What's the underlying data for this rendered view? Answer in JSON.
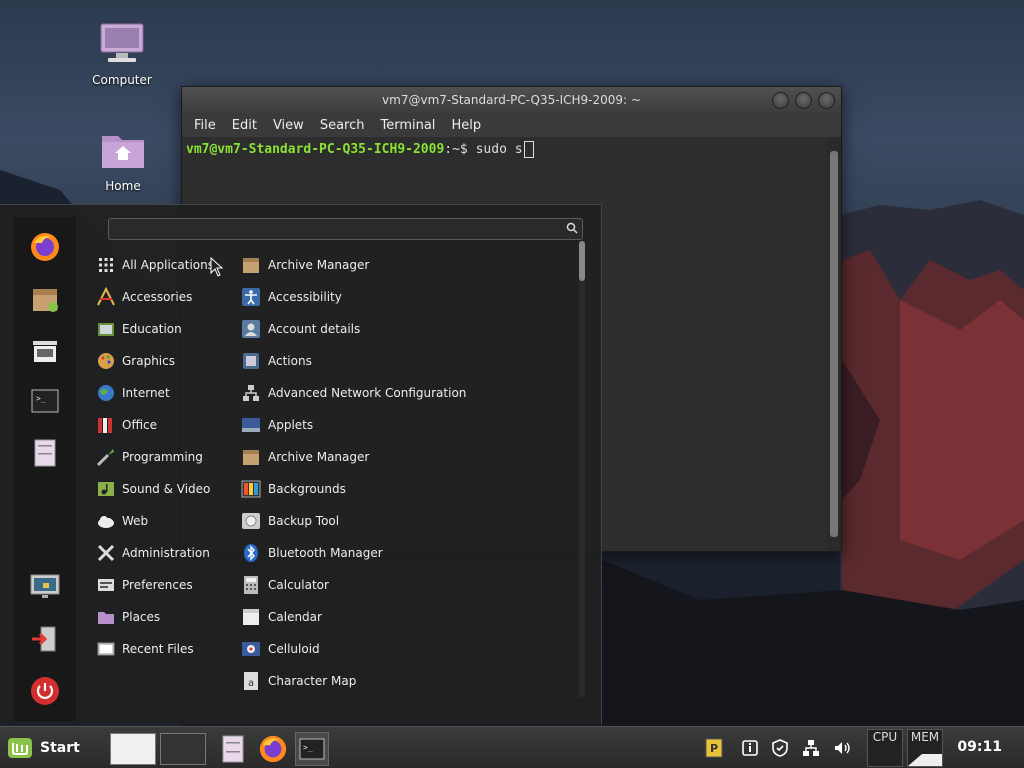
{
  "desktop": {
    "icons": [
      {
        "label": "Computer"
      },
      {
        "label": "Home"
      }
    ]
  },
  "terminal": {
    "title": "vm7@vm7-Standard-PC-Q35-ICH9-2009: ~",
    "menu": [
      "File",
      "Edit",
      "View",
      "Search",
      "Terminal",
      "Help"
    ],
    "prompt_user": "vm7@vm7-Standard-PC-Q35-ICH9-2009",
    "prompt_rest": ":~$ sudo s"
  },
  "menu": {
    "search_value": "",
    "categories": [
      {
        "label": "All Applications",
        "icon": "grid-icon"
      },
      {
        "label": "Accessories",
        "icon": "accessories-icon"
      },
      {
        "label": "Education",
        "icon": "education-icon"
      },
      {
        "label": "Graphics",
        "icon": "graphics-icon"
      },
      {
        "label": "Internet",
        "icon": "globe-icon"
      },
      {
        "label": "Office",
        "icon": "office-icon"
      },
      {
        "label": "Programming",
        "icon": "programming-icon"
      },
      {
        "label": "Sound & Video",
        "icon": "media-icon"
      },
      {
        "label": "Web",
        "icon": "cloud-icon"
      },
      {
        "label": "Administration",
        "icon": "tools-icon"
      },
      {
        "label": "Preferences",
        "icon": "preferences-icon"
      },
      {
        "label": "Places",
        "icon": "folder-icon"
      },
      {
        "label": "Recent Files",
        "icon": "recent-icon"
      }
    ],
    "apps": [
      {
        "label": "Archive Manager",
        "icon": "archive-icon"
      },
      {
        "label": "Accessibility",
        "icon": "accessibility-icon"
      },
      {
        "label": "Account details",
        "icon": "account-icon"
      },
      {
        "label": "Actions",
        "icon": "actions-icon"
      },
      {
        "label": "Advanced Network Configuration",
        "icon": "network-icon"
      },
      {
        "label": "Applets",
        "icon": "applets-icon"
      },
      {
        "label": "Archive Manager",
        "icon": "archive-icon"
      },
      {
        "label": "Backgrounds",
        "icon": "backgrounds-icon"
      },
      {
        "label": "Backup Tool",
        "icon": "backup-icon"
      },
      {
        "label": "Bluetooth Manager",
        "icon": "bluetooth-icon"
      },
      {
        "label": "Calculator",
        "icon": "calculator-icon"
      },
      {
        "label": "Calendar",
        "icon": "calendar-icon"
      },
      {
        "label": "Celluloid",
        "icon": "celluloid-icon"
      },
      {
        "label": "Character Map",
        "icon": "charmap-icon"
      }
    ]
  },
  "panel": {
    "start_label": "Start",
    "cpu_label": "CPU",
    "mem_label": "MEM",
    "clock": "09:11"
  },
  "colors": {
    "prompt_green": "#8ae234",
    "menu_bg": "#202020",
    "panel_bg": "#333333"
  }
}
